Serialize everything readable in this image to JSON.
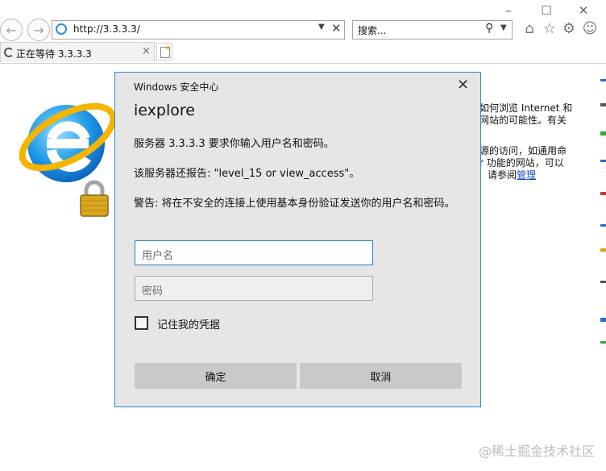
{
  "browser": {
    "address_url": "http://3.3.3.3/",
    "search_placeholder": "搜索...",
    "tab_title": "正在等待 3.3.3.3"
  },
  "background_text": {
    "line1": "如何浏览 Internet 和",
    "line2": "网站的可能性。有关",
    "line3": "源的访问，如通用命",
    "line4": "r 功能的网站，可以",
    "line5_prefix": "请参阅",
    "line5_link": "管理"
  },
  "dialog": {
    "title": "Windows 安全中心",
    "app": "iexplore",
    "message1": "服务器 3.3.3.3 要求你输入用户名和密码。",
    "message2": "该服务器还报告: \"level_15 or view_access\"。",
    "warning": "警告: 将在不安全的连接上使用基本身份验证发送你的用户名和密码。",
    "username_placeholder": "用户名",
    "password_placeholder": "密码",
    "remember_label": "记住我的凭据",
    "ok_label": "确定",
    "cancel_label": "取消"
  },
  "watermark": "@稀土掘金技术社区",
  "colors": {
    "dialog_bg": "#e6e6e6",
    "dialog_border": "#2b8ad6",
    "button_bg": "#c9c9c9",
    "link": "#1a4fc4"
  }
}
